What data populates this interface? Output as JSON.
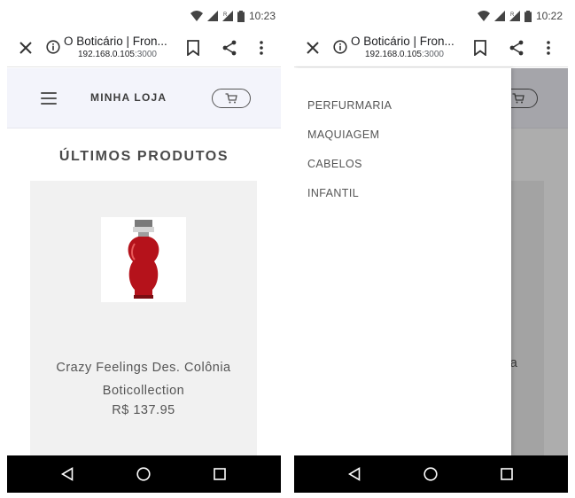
{
  "screens": [
    {
      "status": {
        "time": "10:23"
      },
      "browser": {
        "title": "O Boticário | Fron...",
        "host": "192.168.0.105",
        "port": ":3000"
      },
      "header": {
        "brand": "MINHA LOJA"
      },
      "section_title": "ÚLTIMOS PRODUTOS",
      "product": {
        "name_line1": "Crazy Feelings Des. Colônia",
        "name_line2": "Boticollection",
        "price": "R$ 137.95"
      }
    },
    {
      "status": {
        "time": "10:22"
      },
      "browser": {
        "title": "O Boticário | Fron...",
        "host": "192.168.0.105",
        "port": ":3000"
      },
      "drawer": {
        "items": [
          {
            "label": "PERFURMARIA"
          },
          {
            "label": "MAQUIAGEM"
          },
          {
            "label": "CABELOS"
          },
          {
            "label": "INFANTIL"
          }
        ]
      },
      "background_peek_text": "ia"
    }
  ],
  "icons": {
    "status": [
      "wifi-icon",
      "signal-icon",
      "signal-roaming-icon",
      "battery-icon"
    ],
    "browser": [
      "close-icon",
      "info-icon",
      "bookmark-icon",
      "share-icon",
      "more-vert-icon"
    ],
    "header": [
      "menu-icon",
      "cart-icon"
    ],
    "nav": [
      "back-icon",
      "home-icon",
      "recents-icon"
    ]
  },
  "colors": {
    "header_bg": "#f3f4fb",
    "card_bg": "#f1f1f1",
    "navbar_bg": "#000000",
    "perfume_red": "#b5121b"
  }
}
